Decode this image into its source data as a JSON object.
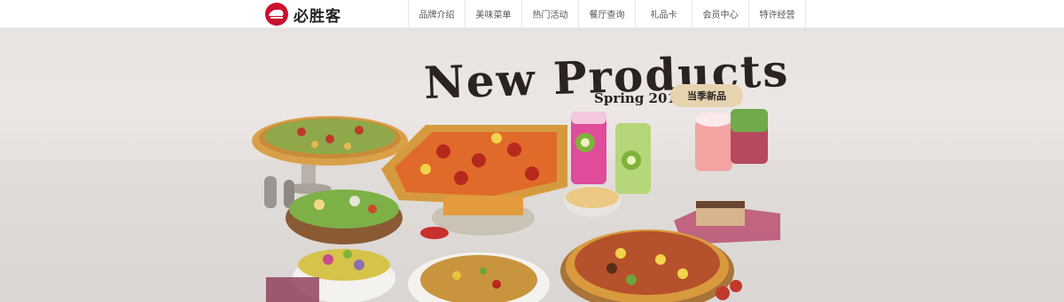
{
  "brand": {
    "name": "必胜客",
    "logo_icon": "pizza-hut-roof-icon",
    "color": "#c8102e"
  },
  "nav": {
    "items": [
      {
        "label": "品牌介绍"
      },
      {
        "label": "美味菜单"
      },
      {
        "label": "热门活动"
      },
      {
        "label": "餐厅查询"
      },
      {
        "label": "礼品卡"
      },
      {
        "label": "会员中心"
      },
      {
        "label": "特许经营"
      }
    ]
  },
  "banner": {
    "headline": "New Products",
    "season": "Spring 2018",
    "badge": "当季新品",
    "accent": "#e6d3b0"
  }
}
